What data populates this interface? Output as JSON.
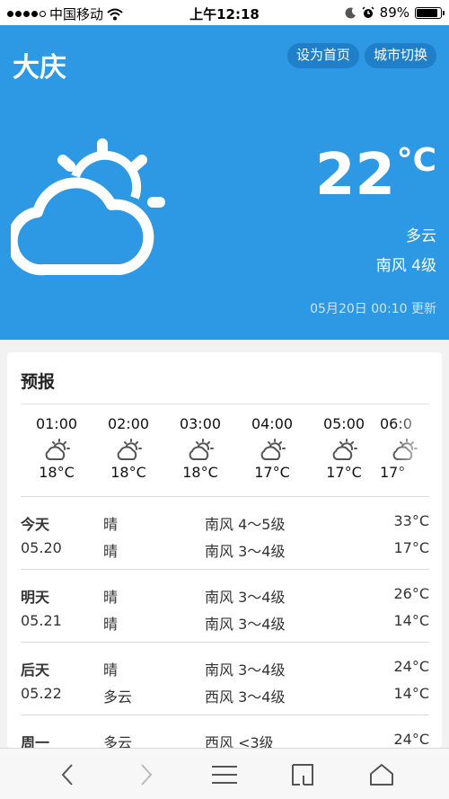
{
  "status_bar": {
    "carrier": "中国移动",
    "time": "上午12:18",
    "battery": "89%",
    "battery_level": 0.89
  },
  "hero": {
    "city": "大庆",
    "set_home_label": "设为首页",
    "switch_city_label": "城市切换",
    "temperature": "22",
    "unit": "°C",
    "condition": "多云",
    "wind": "南风 4级",
    "updated": "05月20日 00:10 更新",
    "icon": "partly-cloudy-icon"
  },
  "forecast": {
    "title": "预报",
    "hourly": [
      {
        "time": "01:00",
        "temp": "18°C",
        "icon": "partly-cloudy-icon"
      },
      {
        "time": "02:00",
        "temp": "18°C",
        "icon": "partly-cloudy-icon"
      },
      {
        "time": "03:00",
        "temp": "18°C",
        "icon": "partly-cloudy-icon"
      },
      {
        "time": "04:00",
        "temp": "17°C",
        "icon": "partly-cloudy-icon"
      },
      {
        "time": "05:00",
        "temp": "17°C",
        "icon": "partly-cloudy-icon"
      },
      {
        "time": "06:0",
        "temp": "17°",
        "icon": "partly-cloudy-icon"
      }
    ],
    "daily": [
      {
        "day": "今天",
        "date": "05.20",
        "cond1": "晴",
        "cond2": "晴",
        "wind1": "南风 4～5级",
        "wind2": "南风 3～4级",
        "high": "33°C",
        "low": "17°C"
      },
      {
        "day": "明天",
        "date": "05.21",
        "cond1": "晴",
        "cond2": "晴",
        "wind1": "南风 3～4级",
        "wind2": "南风 3～4级",
        "high": "26°C",
        "low": "14°C"
      },
      {
        "day": "后天",
        "date": "05.22",
        "cond1": "晴",
        "cond2": "多云",
        "wind1": "南风 3～4级",
        "wind2": "西风 3～4级",
        "high": "24°C",
        "low": "14°C"
      },
      {
        "day": "周一",
        "date": "",
        "cond1": "多云",
        "cond2": "",
        "wind1": "西风 <3级",
        "wind2": "",
        "high": "24°C",
        "low": ""
      }
    ]
  },
  "toolbar": {
    "items": [
      "back-icon",
      "forward-icon",
      "menu-icon",
      "tabs-icon",
      "home-icon"
    ]
  },
  "colors": {
    "hero_bg": "#2d98e4",
    "button_bg": "#1f7fc8"
  }
}
